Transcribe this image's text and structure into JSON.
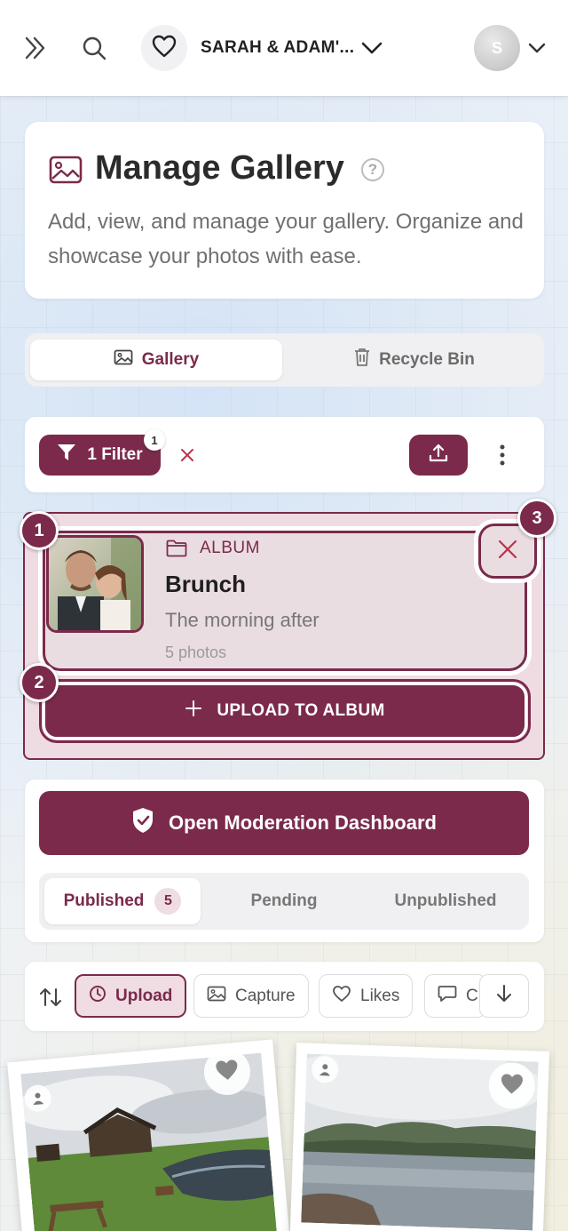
{
  "header": {
    "expand_icon": "double-chevron-right-icon",
    "search_icon": "search-icon",
    "event_name": "SARAH & ADAM'...",
    "avatar_initial": "S"
  },
  "gallery_card": {
    "title": "Manage Gallery",
    "help": "?",
    "description": "Add, view, and manage your gallery. Organize and showcase your photos with ease."
  },
  "tabs": [
    {
      "label": "Gallery",
      "icon": "image-icon",
      "active": true
    },
    {
      "label": "Recycle Bin",
      "icon": "trash-icon",
      "active": false
    }
  ],
  "toolbar": {
    "filter_label": "1 Filter",
    "filter_badge": "1",
    "clear": "×"
  },
  "album": {
    "label": "ALBUM",
    "name": "Brunch",
    "subtitle": "The morning after",
    "count": "5 photos",
    "upload_label": "UPLOAD TO ALBUM",
    "steps": [
      "1",
      "2",
      "3"
    ]
  },
  "moderation": {
    "button_label": "Open Moderation Dashboard",
    "tabs": [
      {
        "label": "Published",
        "count": "5",
        "active": true
      },
      {
        "label": "Pending",
        "active": false
      },
      {
        "label": "Unpublished",
        "active": false
      }
    ]
  },
  "sort": {
    "chips": [
      {
        "label": "Upload",
        "icon": "clock-icon",
        "active": true
      },
      {
        "label": "Capture",
        "icon": "image-icon",
        "active": false
      },
      {
        "label": "Likes",
        "icon": "heart-icon",
        "active": false
      },
      {
        "label": "C",
        "icon": "comment-icon",
        "active": false
      }
    ]
  },
  "colors": {
    "accent": "#7b2a4b",
    "accent_light": "#efdde3"
  }
}
